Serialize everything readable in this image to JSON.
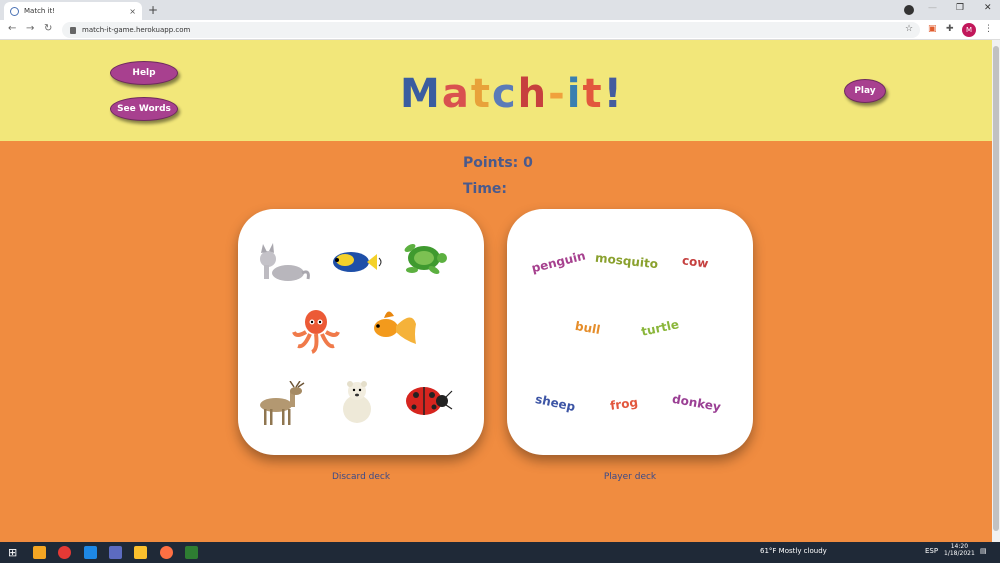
{
  "browser": {
    "tab_title": "Match it!",
    "tab_close": "×",
    "new_tab": "+",
    "url": "match-it-game.herokuapp.com",
    "profile_initial": "M",
    "win_minimize": "—",
    "win_restore": "❐",
    "win_close": "✕"
  },
  "header": {
    "help_label": "Help",
    "see_words_label": "See Words",
    "play_label": "Play",
    "logo_letters": [
      "M",
      "a",
      "t",
      "c",
      "h",
      "-",
      "i",
      "t",
      "!"
    ]
  },
  "stats": {
    "points_label": "Points: 0",
    "time_label": "Time:"
  },
  "discard_deck": {
    "label": "Discard deck",
    "animals": [
      "cat",
      "fish",
      "turtle",
      "octopus",
      "goldfish",
      "deer",
      "polar-bear",
      "ladybug"
    ]
  },
  "player_deck": {
    "label": "Player deck",
    "words": [
      "penguin",
      "mosquito",
      "cow",
      "bull",
      "turtle",
      "sheep",
      "frog",
      "donkey"
    ]
  },
  "colors": {
    "header_bg": "#f2e77a",
    "page_bg": "#f08c40",
    "button_bg": "#a8408f",
    "stats_text": "#4a5a8c"
  },
  "taskbar": {
    "weather": "61°F  Mostly cloudy",
    "language": "ESP",
    "time": "14:20",
    "date": "1/18/2021"
  }
}
